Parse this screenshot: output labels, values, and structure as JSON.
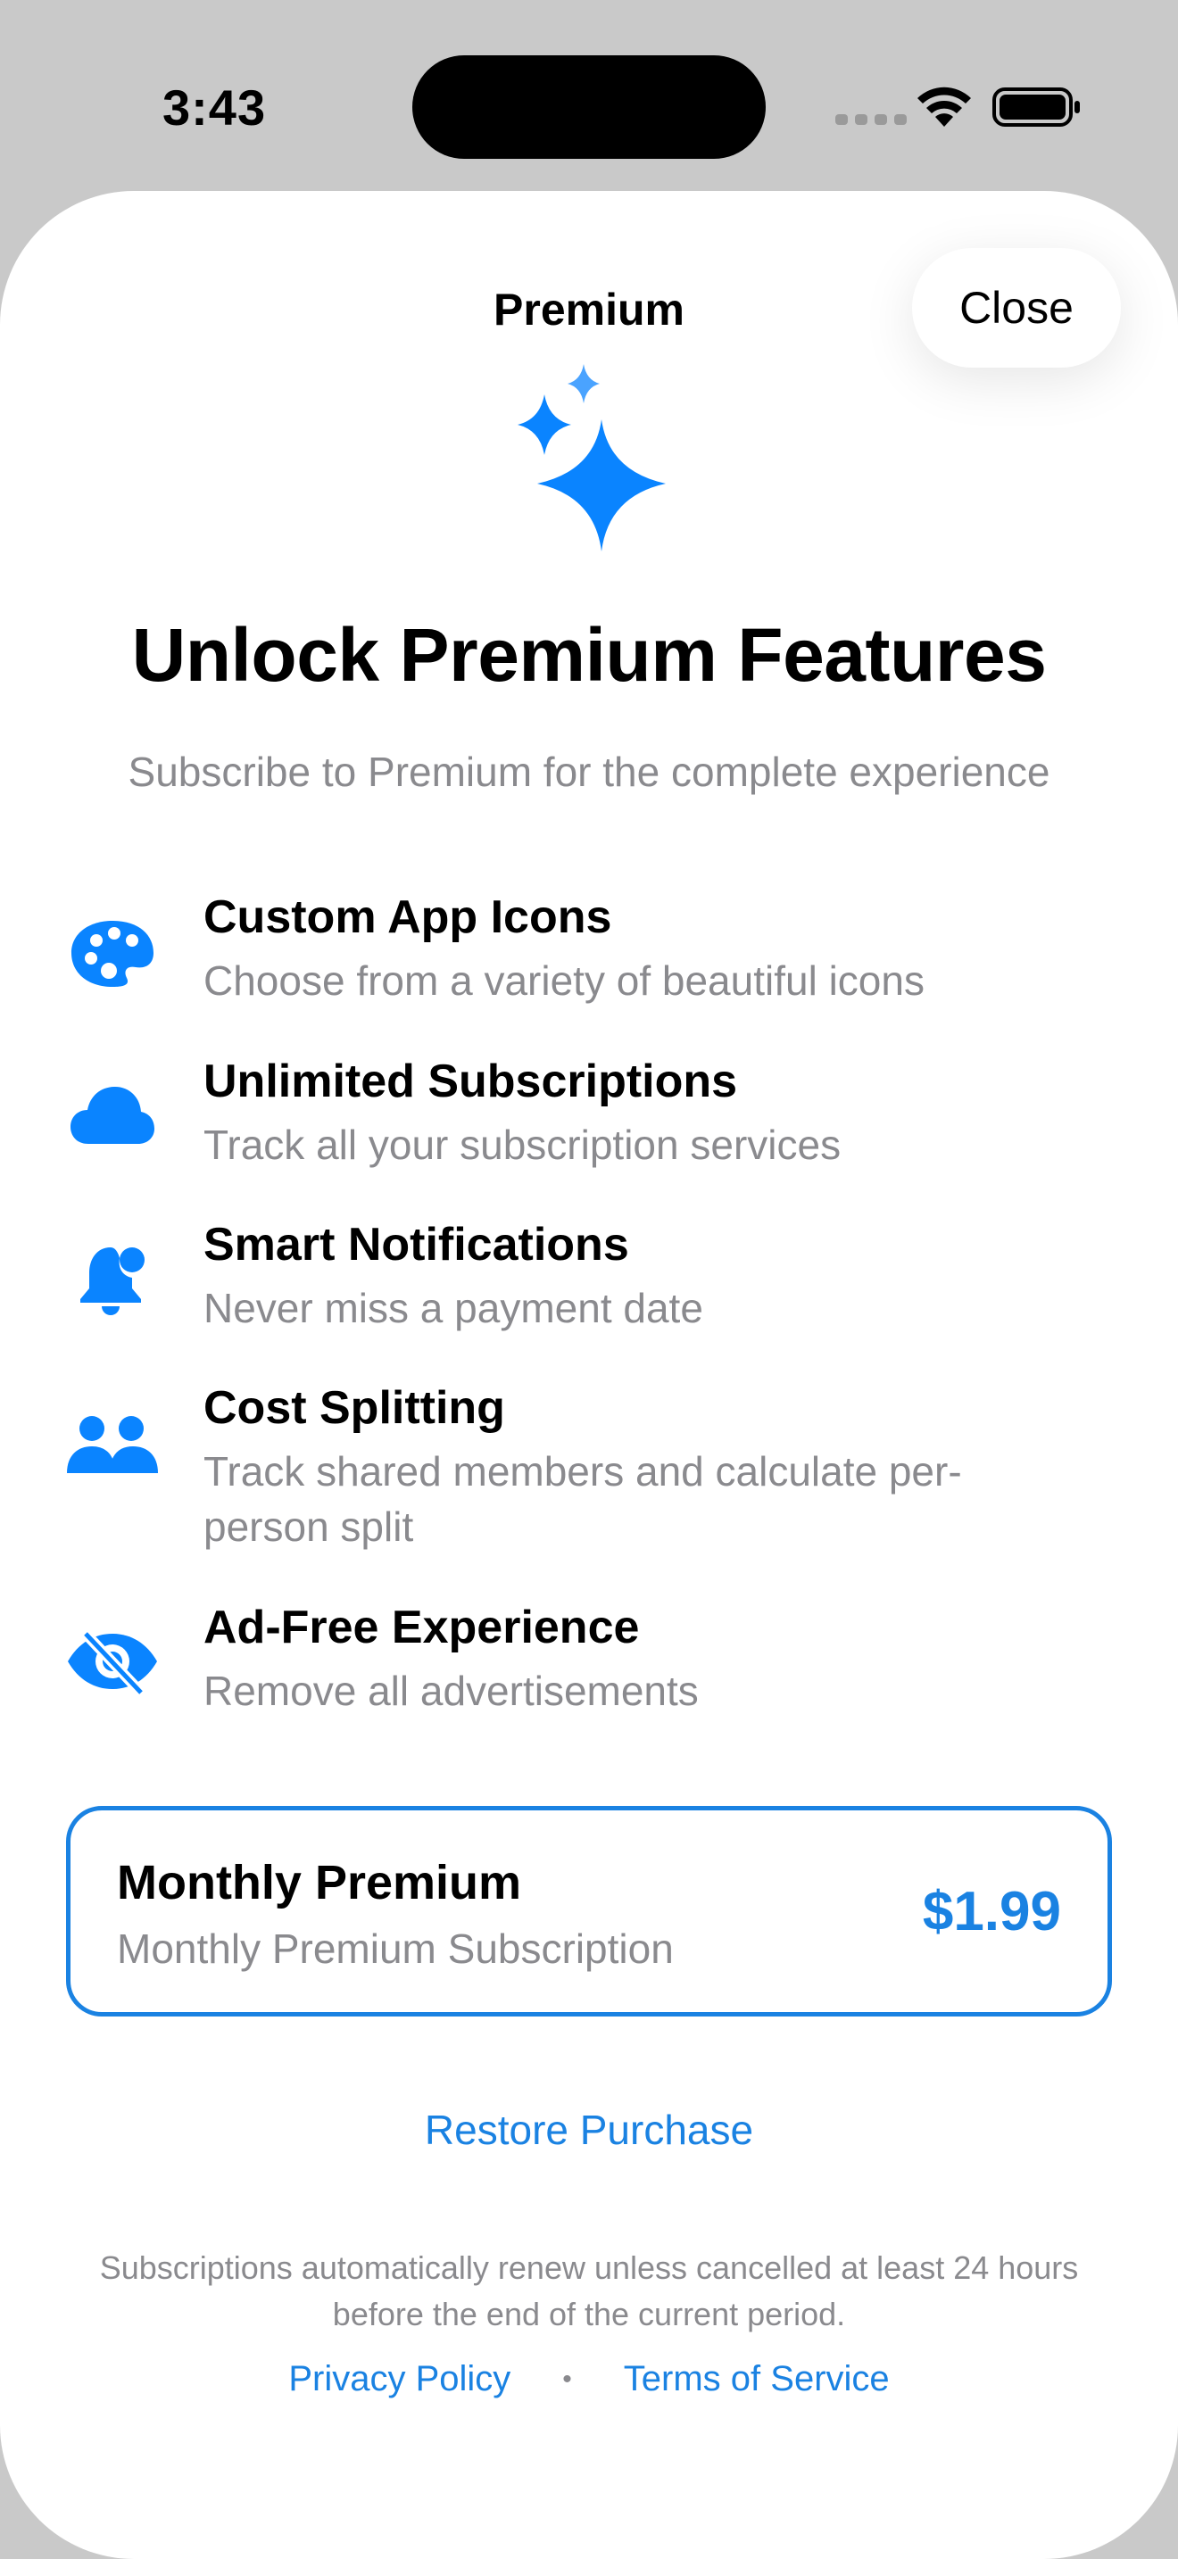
{
  "status_bar": {
    "time": "3:43"
  },
  "sheet": {
    "title": "Premium",
    "close_label": "Close"
  },
  "hero": {
    "icon": "sparkles-icon",
    "headline": "Unlock Premium Features",
    "subheadline": "Subscribe to Premium for the complete experience"
  },
  "features": [
    {
      "icon": "palette-icon",
      "title": "Custom App Icons",
      "description": "Choose from a variety of beautiful icons"
    },
    {
      "icon": "cloud-icon",
      "title": "Unlimited Subscriptions",
      "description": "Track all your subscription services"
    },
    {
      "icon": "bell-badge-icon",
      "title": "Smart Notifications",
      "description": "Never miss a payment date"
    },
    {
      "icon": "people-icon",
      "title": "Cost Splitting",
      "description": "Track shared members and calculate per-person split"
    },
    {
      "icon": "eye-slash-icon",
      "title": "Ad-Free Experience",
      "description": "Remove all advertisements"
    }
  ],
  "plan": {
    "name": "Monthly Premium",
    "description": "Monthly Premium Subscription",
    "price": "$1.99"
  },
  "restore_label": "Restore Purchase",
  "legal_text": "Subscriptions automatically renew unless cancelled at least 24 hours before the end of the current period.",
  "links": {
    "privacy": "Privacy Policy",
    "separator": "•",
    "terms": "Terms of Service"
  },
  "colors": {
    "accent": "#1a82e2",
    "icon_blue": "#0a84ff",
    "secondary_text": "#8a8a8e"
  }
}
